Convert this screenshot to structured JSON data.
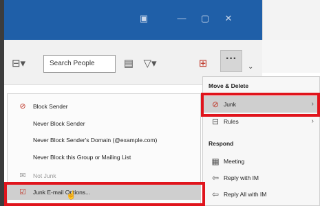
{
  "ribbon": {
    "search_people_label": "Search People"
  },
  "junk_submenu": {
    "items": [
      {
        "label": "Block Sender",
        "icon": "block-sender-icon",
        "disabled": false
      },
      {
        "label": "Never Block Sender",
        "icon": "",
        "disabled": false
      },
      {
        "label": "Never Block Sender's Domain (@example.com)",
        "icon": "",
        "disabled": false
      },
      {
        "label": "Never Block this Group or Mailing List",
        "icon": "",
        "disabled": false
      },
      {
        "label": "Not Junk",
        "icon": "not-junk-icon",
        "disabled": true
      },
      {
        "label": "Junk E-mail Options...",
        "icon": "junk-options-icon",
        "disabled": false
      }
    ]
  },
  "context_menu": {
    "section_move_delete": "Move & Delete",
    "junk_label": "Junk",
    "rules_label": "Rules",
    "section_respond": "Respond",
    "meeting_label": "Meeting",
    "reply_im_label": "Reply with IM",
    "reply_all_im_label": "Reply All with IM"
  },
  "highlight_color": "#e0141c",
  "titlebar_color": "#1f5fa8"
}
